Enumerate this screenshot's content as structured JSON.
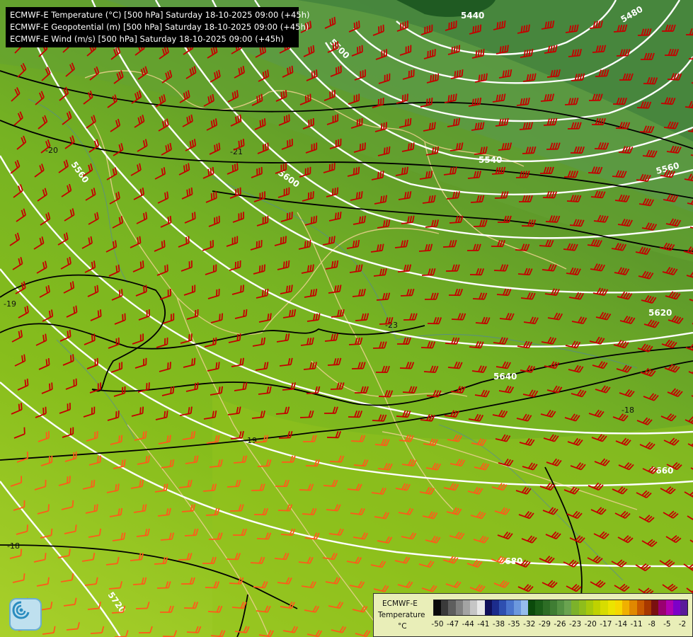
{
  "title_lines": [
    "ECMWF-E Temperature (°C) [500 hPa] Saturday 18-10-2025 09:00 (+45h)",
    "ECMWF-E Geopotential (m) [500 hPa] Saturday 18-10-2025 09:00 (+45h)",
    "ECMWF-E Wind (m/s) [500 hPa] Saturday 18-10-2025 09:00 (+45h)"
  ],
  "legend": {
    "title_lines": [
      "ECMWF-E",
      "Temperature",
      "°C"
    ],
    "ticks": [
      "-50",
      "-47",
      "-44",
      "-41",
      "-38",
      "-35",
      "-32",
      "-29",
      "-26",
      "-23",
      "-20",
      "-17",
      "-14",
      "-11",
      "-8",
      "-5",
      "-2"
    ],
    "colors": [
      "#0a0a0a",
      "#3a3a3a",
      "#5e5e5e",
      "#808080",
      "#a3a3a3",
      "#c6c6c6",
      "#e8e8e8",
      "#10105a",
      "#1c2c8c",
      "#2e4fb0",
      "#4a74cc",
      "#6c98de",
      "#95bdec",
      "#0b4a0b",
      "#1a5d17",
      "#2d6d25",
      "#3f7d33",
      "#549142",
      "#6aa350",
      "#7cb22a",
      "#8fbd1c",
      "#a6c90c",
      "#bfd200",
      "#d7dc00",
      "#ece400",
      "#f6d800",
      "#f0b000",
      "#e08800",
      "#c85a00",
      "#a83800",
      "#7a1010",
      "#9a0070",
      "#b000b0",
      "#7d00c8",
      "#5a1a9a"
    ]
  },
  "geopotential_labels": [
    "5440",
    "5480",
    "5500",
    "5540",
    "5560",
    "5580",
    "5600",
    "5620",
    "5640",
    "5660",
    "5680",
    "5720"
  ],
  "temperature_labels": [
    "-18",
    "-19",
    "-19",
    "-20",
    "-21",
    "-23",
    "-18"
  ],
  "colors": {
    "geopotential": "#ffffff",
    "temperature_isotherm": "#000000",
    "wind_barb_cold": "#c40000",
    "wind_barb_warm": "#ff5a1a",
    "border": "#e6cf8a"
  }
}
